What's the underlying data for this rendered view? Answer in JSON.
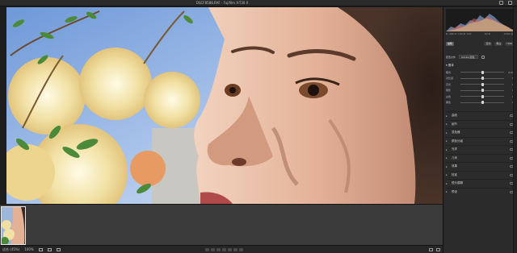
{
  "window": {
    "title": "DSCF8588.RAF - Fujifilm X-T30 II"
  },
  "panel": {
    "tabs": [
      "编辑",
      "自动",
      "黑白",
      "HDR"
    ],
    "profile_label": "配置文件",
    "profile_value": "Adobe 颜色",
    "readout": [
      "R: 180  G: 150  B: 120",
      "f/2.8",
      "1/500 秒"
    ],
    "basic_header": "基本",
    "sliders": [
      {
        "label": "曝光",
        "value": "0.00",
        "pos": 0.5
      },
      {
        "label": "对比度",
        "value": "0",
        "pos": 0.5
      },
      {
        "label": "高光",
        "value": "0",
        "pos": 0.5
      },
      {
        "label": "阴影",
        "value": "0",
        "pos": 0.5
      },
      {
        "label": "白色",
        "value": "0",
        "pos": 0.5
      },
      {
        "label": "黑色",
        "value": "0",
        "pos": 0.5
      }
    ],
    "sections": [
      "曲线",
      "细节",
      "混色器",
      "颜色分级",
      "光学",
      "几何",
      "效果",
      "校准",
      "镜头模糊",
      "预设"
    ]
  },
  "status": {
    "zoom": "适合 (45%)",
    "zoom_alt": "100%"
  },
  "colors": {
    "accent": "#3d8ee0",
    "panel_bg": "#2b2b2b",
    "app_bg": "#1e1e1e"
  }
}
